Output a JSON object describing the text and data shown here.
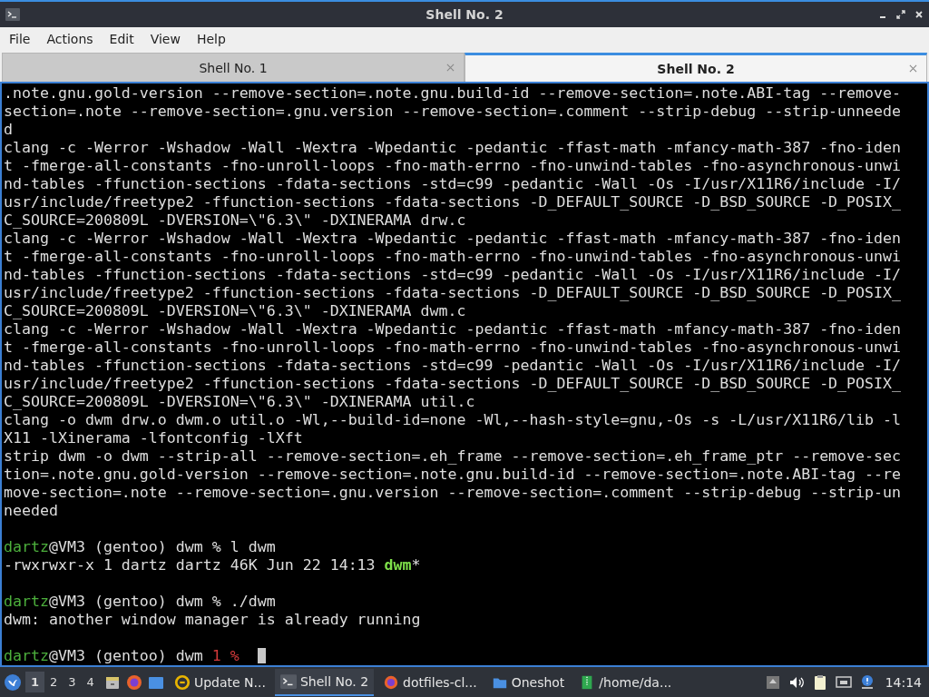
{
  "window": {
    "title": "Shell No. 2"
  },
  "menu": [
    "File",
    "Actions",
    "Edit",
    "View",
    "Help"
  ],
  "tabs": [
    {
      "label": "Shell No. 1",
      "selected": false
    },
    {
      "label": "Shell No. 2",
      "selected": true
    }
  ],
  "terminal": {
    "cursor_visible": true,
    "lines": [
      {
        "kind": "text",
        "segments": [
          {
            "kind": "plain",
            "text": ".note.gnu.gold-version --remove-section=.note.gnu.build-id --remove-section=.note.ABI-tag --remove-"
          }
        ]
      },
      {
        "kind": "text",
        "segments": [
          {
            "kind": "plain",
            "text": "section=.note --remove-section=.gnu.version --remove-section=.comment --strip-debug --strip-unneede"
          }
        ]
      },
      {
        "kind": "text",
        "segments": [
          {
            "kind": "plain",
            "text": "d"
          }
        ]
      },
      {
        "kind": "text",
        "segments": [
          {
            "kind": "plain",
            "text": "clang -c -Werror -Wshadow -Wall -Wextra -Wpedantic -pedantic -ffast-math -mfancy-math-387 -fno-iden"
          }
        ]
      },
      {
        "kind": "text",
        "segments": [
          {
            "kind": "plain",
            "text": "t -fmerge-all-constants -fno-unroll-loops -fno-math-errno -fno-unwind-tables -fno-asynchronous-unwi"
          }
        ]
      },
      {
        "kind": "text",
        "segments": [
          {
            "kind": "plain",
            "text": "nd-tables -ffunction-sections -fdata-sections -std=c99 -pedantic -Wall -Os -I/usr/X11R6/include -I/"
          }
        ]
      },
      {
        "kind": "text",
        "segments": [
          {
            "kind": "plain",
            "text": "usr/include/freetype2 -ffunction-sections -fdata-sections -D_DEFAULT_SOURCE -D_BSD_SOURCE -D_POSIX_"
          }
        ]
      },
      {
        "kind": "text",
        "segments": [
          {
            "kind": "plain",
            "text": "C_SOURCE=200809L -DVERSION=\\\"6.3\\\" -DXINERAMA drw.c"
          }
        ]
      },
      {
        "kind": "text",
        "segments": [
          {
            "kind": "plain",
            "text": "clang -c -Werror -Wshadow -Wall -Wextra -Wpedantic -pedantic -ffast-math -mfancy-math-387 -fno-iden"
          }
        ]
      },
      {
        "kind": "text",
        "segments": [
          {
            "kind": "plain",
            "text": "t -fmerge-all-constants -fno-unroll-loops -fno-math-errno -fno-unwind-tables -fno-asynchronous-unwi"
          }
        ]
      },
      {
        "kind": "text",
        "segments": [
          {
            "kind": "plain",
            "text": "nd-tables -ffunction-sections -fdata-sections -std=c99 -pedantic -Wall -Os -I/usr/X11R6/include -I/"
          }
        ]
      },
      {
        "kind": "text",
        "segments": [
          {
            "kind": "plain",
            "text": "usr/include/freetype2 -ffunction-sections -fdata-sections -D_DEFAULT_SOURCE -D_BSD_SOURCE -D_POSIX_"
          }
        ]
      },
      {
        "kind": "text",
        "segments": [
          {
            "kind": "plain",
            "text": "C_SOURCE=200809L -DVERSION=\\\"6.3\\\" -DXINERAMA dwm.c"
          }
        ]
      },
      {
        "kind": "text",
        "segments": [
          {
            "kind": "plain",
            "text": "clang -c -Werror -Wshadow -Wall -Wextra -Wpedantic -pedantic -ffast-math -mfancy-math-387 -fno-iden"
          }
        ]
      },
      {
        "kind": "text",
        "segments": [
          {
            "kind": "plain",
            "text": "t -fmerge-all-constants -fno-unroll-loops -fno-math-errno -fno-unwind-tables -fno-asynchronous-unwi"
          }
        ]
      },
      {
        "kind": "text",
        "segments": [
          {
            "kind": "plain",
            "text": "nd-tables -ffunction-sections -fdata-sections -std=c99 -pedantic -Wall -Os -I/usr/X11R6/include -I/"
          }
        ]
      },
      {
        "kind": "text",
        "segments": [
          {
            "kind": "plain",
            "text": "usr/include/freetype2 -ffunction-sections -fdata-sections -D_DEFAULT_SOURCE -D_BSD_SOURCE -D_POSIX_"
          }
        ]
      },
      {
        "kind": "text",
        "segments": [
          {
            "kind": "plain",
            "text": "C_SOURCE=200809L -DVERSION=\\\"6.3\\\" -DXINERAMA util.c"
          }
        ]
      },
      {
        "kind": "text",
        "segments": [
          {
            "kind": "plain",
            "text": "clang -o dwm drw.o dwm.o util.o -Wl,--build-id=none -Wl,--hash-style=gnu,-Os -s -L/usr/X11R6/lib -l"
          }
        ]
      },
      {
        "kind": "text",
        "segments": [
          {
            "kind": "plain",
            "text": "X11 -lXinerama -lfontconfig -lXft"
          }
        ]
      },
      {
        "kind": "text",
        "segments": [
          {
            "kind": "plain",
            "text": "strip dwm -o dwm --strip-all --remove-section=.eh_frame --remove-section=.eh_frame_ptr --remove-sec"
          }
        ]
      },
      {
        "kind": "text",
        "segments": [
          {
            "kind": "plain",
            "text": "tion=.note.gnu.gold-version --remove-section=.note.gnu.build-id --remove-section=.note.ABI-tag --re"
          }
        ]
      },
      {
        "kind": "text",
        "segments": [
          {
            "kind": "plain",
            "text": "move-section=.note --remove-section=.gnu.version --remove-section=.comment --strip-debug --strip-un"
          }
        ]
      },
      {
        "kind": "text",
        "segments": [
          {
            "kind": "plain",
            "text": "needed"
          }
        ]
      },
      {
        "kind": "blank"
      },
      {
        "kind": "text",
        "segments": [
          {
            "kind": "user",
            "text": "dartz"
          },
          {
            "kind": "plain",
            "text": "@VM3 (gentoo) dwm % l dwm"
          }
        ]
      },
      {
        "kind": "text",
        "segments": [
          {
            "kind": "plain",
            "text": "-rwxrwxr-x 1 dartz dartz 46K Jun 22 14:13 "
          },
          {
            "kind": "executable",
            "text": "dwm"
          },
          {
            "kind": "plain",
            "text": "*"
          }
        ]
      },
      {
        "kind": "blank"
      },
      {
        "kind": "text",
        "segments": [
          {
            "kind": "user",
            "text": "dartz"
          },
          {
            "kind": "plain",
            "text": "@VM3 (gentoo) dwm % ./dwm"
          }
        ]
      },
      {
        "kind": "text",
        "segments": [
          {
            "kind": "plain",
            "text": "dwm: another window manager is already running"
          }
        ]
      },
      {
        "kind": "blank"
      },
      {
        "kind": "text",
        "segments": [
          {
            "kind": "user",
            "text": "dartz"
          },
          {
            "kind": "plain",
            "text": "@VM3 (gentoo) dwm "
          },
          {
            "kind": "exit-code",
            "text": "1 %"
          }
        ]
      }
    ]
  },
  "taskbar": {
    "desktops": [
      {
        "label": "1",
        "selected": true
      },
      {
        "label": "2",
        "selected": false
      },
      {
        "label": "3",
        "selected": false
      },
      {
        "label": "4",
        "selected": false
      }
    ],
    "tasks": [
      {
        "label": "Update N...",
        "selected": false
      },
      {
        "label": "Shell No. 2",
        "selected": true
      },
      {
        "label": "dotfiles-cl...",
        "selected": false
      },
      {
        "label": "Oneshot",
        "selected": false
      },
      {
        "label": "/home/da...",
        "selected": false
      }
    ],
    "clock": "14:14"
  }
}
